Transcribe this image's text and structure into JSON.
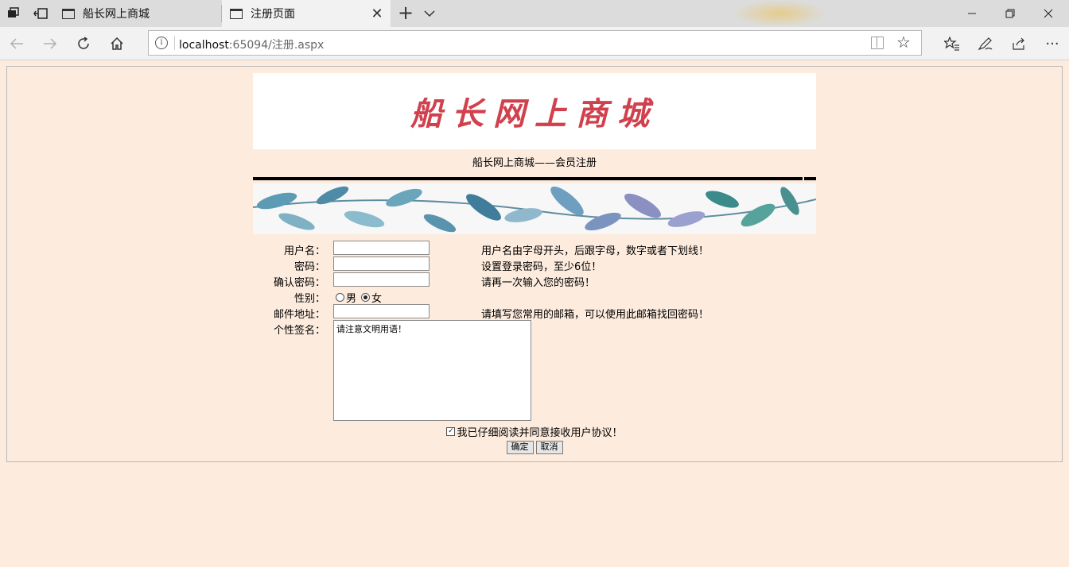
{
  "browser": {
    "tabs": [
      {
        "title": "船长网上商城",
        "active": false
      },
      {
        "title": "注册页面",
        "active": true
      }
    ],
    "url": {
      "host": "localhost",
      "rest": ":65094/注册.aspx"
    }
  },
  "page": {
    "banner_title": "船长网上商城",
    "subtitle": "船长网上商城——会员注册",
    "form": {
      "username": {
        "label": "用户名：",
        "value": "",
        "hint": "用户名由字母开头，后跟字母，数字或者下划线！"
      },
      "password": {
        "label": "密码：",
        "value": "",
        "hint": "设置登录密码，至少6位！"
      },
      "confirm": {
        "label": "确认密码：",
        "value": "",
        "hint": "请再一次输入您的密码！"
      },
      "gender": {
        "label": "性别：",
        "options": [
          "男",
          "女"
        ],
        "selected": "女"
      },
      "email": {
        "label": "邮件地址：",
        "value": "",
        "hint": "请填写您常用的邮箱，可以使用此邮箱找回密码！"
      },
      "signature": {
        "label": "个性签名：",
        "value": "请注意文明用语！"
      },
      "agree": {
        "label": "我已仔细阅读并同意接收用户协议！",
        "checked": true
      },
      "submit_label": "确定",
      "cancel_label": "取消"
    }
  },
  "icons": {
    "back": "back-arrow-icon",
    "forward": "forward-arrow-icon",
    "refresh": "refresh-icon",
    "home": "home-icon",
    "favorite": "star-icon"
  },
  "colors": {
    "page_bg": "#fdebdd",
    "banner_title": "#d0414d"
  }
}
